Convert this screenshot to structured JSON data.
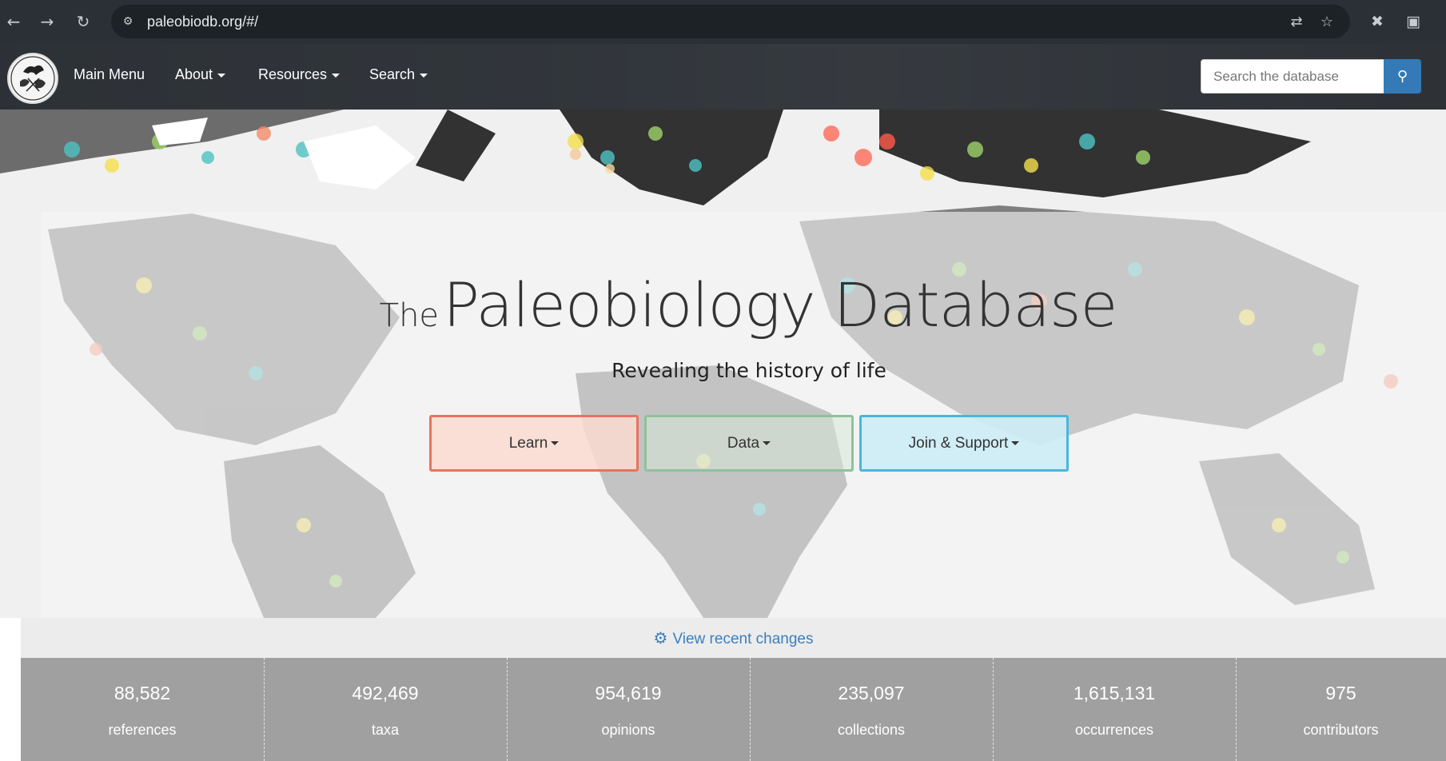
{
  "browser": {
    "url": "paleobiodb.org/#/",
    "icons": [
      "back-icon",
      "forward-icon",
      "reload-icon",
      "site-settings-icon",
      "translate-icon",
      "bookmark-star-icon",
      "mute-icon",
      "extensions-icon"
    ]
  },
  "navbar": {
    "items": [
      {
        "label": "Main Menu",
        "dropdown": false
      },
      {
        "label": "About",
        "dropdown": true
      },
      {
        "label": "Resources",
        "dropdown": true
      },
      {
        "label": "Search",
        "dropdown": true
      }
    ],
    "search_placeholder": "Search the database",
    "search_icon": "search-icon"
  },
  "hero": {
    "title_prefix": "The",
    "title_main": "Paleobiology Database",
    "subtitle": "Revealing the history of life",
    "buttons": [
      {
        "label": "Learn",
        "color": "#e8735f",
        "bg": "rgba(250,218,208,0.85)"
      },
      {
        "label": "Data",
        "color": "#8fc29a",
        "bg": "rgba(215,232,214,0.55)"
      },
      {
        "label": "Join & Support",
        "color": "#49b6dc",
        "bg": "rgba(205,236,245,0.9)"
      }
    ]
  },
  "recent_changes": {
    "label": "View recent changes",
    "icon": "gears-icon"
  },
  "stats": [
    {
      "value": "88,582",
      "label": "references"
    },
    {
      "value": "492,469",
      "label": "taxa"
    },
    {
      "value": "954,619",
      "label": "opinions"
    },
    {
      "value": "235,097",
      "label": "collections"
    },
    {
      "value": "1,615,131",
      "label": "occurrences"
    },
    {
      "value": "975",
      "label": "contributors"
    }
  ],
  "colors": {
    "accent": "#337ab7",
    "link": "#3a7fc1",
    "stats_bg": "#a0a0a0"
  }
}
